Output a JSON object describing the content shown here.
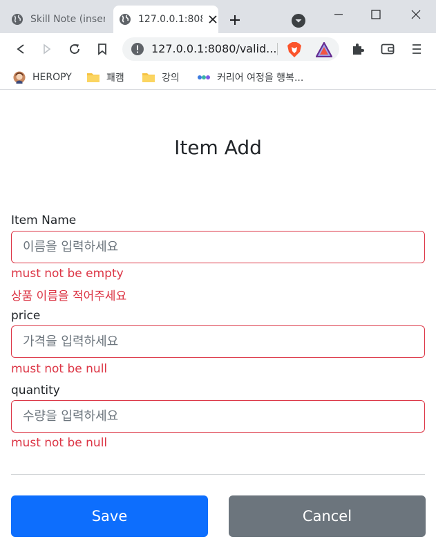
{
  "browser": {
    "tabs": [
      {
        "title": "Skill Note (insert…",
        "active": false
      },
      {
        "title": "127.0.0.1:8080/vali",
        "active": true
      }
    ],
    "address": {
      "url": "127.0.0.1:8080/valid..."
    },
    "bookmarks": [
      {
        "label": "HEROPY",
        "icon": "avatar-icon"
      },
      {
        "label": "패캠",
        "icon": "folder-icon"
      },
      {
        "label": "강의",
        "icon": "folder-icon"
      },
      {
        "label": "커리어 여정을 행복...",
        "icon": "dots-icon"
      }
    ]
  },
  "form": {
    "title": "Item Add",
    "fields": [
      {
        "label": "Item Name",
        "placeholder": "이름을 입력하세요",
        "errors": [
          "must not be empty",
          "상품 이름을 적어주세요"
        ]
      },
      {
        "label": "price",
        "placeholder": "가격을 입력하세요",
        "errors": [
          "must not be null"
        ]
      },
      {
        "label": "quantity",
        "placeholder": "수량을 입력하세요",
        "errors": [
          "must not be null"
        ]
      }
    ],
    "save_label": "Save",
    "cancel_label": "Cancel"
  },
  "colors": {
    "primary": "#0d6efd",
    "secondary": "#6c757d",
    "danger": "#dc3545",
    "tabstrip": "#dee1e6"
  }
}
